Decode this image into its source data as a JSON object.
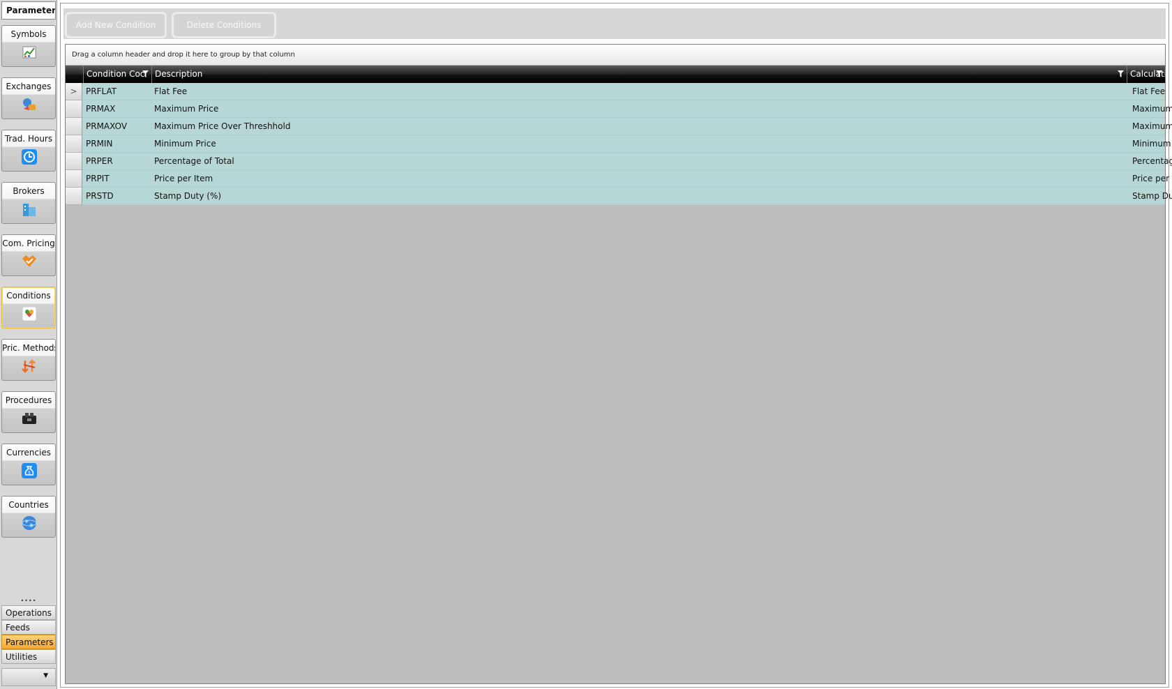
{
  "nav": {
    "header": "Parameters",
    "items": [
      {
        "label": "Symbols",
        "icon": "symbols-chart-icon"
      },
      {
        "label": "Exchanges",
        "icon": "exchanges-icon"
      },
      {
        "label": "Trad. Hours",
        "icon": "clock-icon"
      },
      {
        "label": "Brokers",
        "icon": "brokers-building-icon"
      },
      {
        "label": "Com. Pricing",
        "icon": "tag-icon"
      },
      {
        "label": "Conditions",
        "icon": "conditions-icon",
        "active": true
      },
      {
        "label": "Pric. Methods",
        "icon": "pricing-methods-icon"
      },
      {
        "label": "Procedures",
        "icon": "procedures-icon"
      },
      {
        "label": "Currencies",
        "icon": "money-bag-icon"
      },
      {
        "label": "Countries",
        "icon": "globe-icon"
      }
    ],
    "sections": [
      {
        "label": "Operations"
      },
      {
        "label": "Feeds"
      },
      {
        "label": "Parameters",
        "active": true
      },
      {
        "label": "Utilities"
      }
    ]
  },
  "toolbar": {
    "add_label": "Add New Condition",
    "delete_label": "Delete Conditions"
  },
  "grid": {
    "group_hint": "Drag a column header and drop it here to group by that column",
    "columns": [
      "Condition Coc",
      "Description",
      "Calculation Type"
    ],
    "rows": [
      {
        "code": "PRFLAT",
        "description": "Flat Fee",
        "calc_type": "Flat Fee",
        "current": true
      },
      {
        "code": "PRMAX",
        "description": "Maximum Price",
        "calc_type": "Maximum price"
      },
      {
        "code": "PRMAXOV",
        "description": "Maximum Price Over Threshhold",
        "calc_type": "Maximum price"
      },
      {
        "code": "PRMIN",
        "description": "Minimum Price",
        "calc_type": "Minimum price"
      },
      {
        "code": "PRPER",
        "description": "Percentage of Total",
        "calc_type": "Percentage"
      },
      {
        "code": "PRPIT",
        "description": "Price per Item",
        "calc_type": "Price per Item"
      },
      {
        "code": "PRSTD",
        "description": "Stamp Duty (%)",
        "calc_type": "Stamp Duty"
      }
    ],
    "current_row_marker": ">"
  },
  "colors": {
    "row_background": "#b7d7d7",
    "grid_empty": "#bdbdbd",
    "section_active": "#f4a834",
    "nav_active_border": "#e8b830"
  }
}
